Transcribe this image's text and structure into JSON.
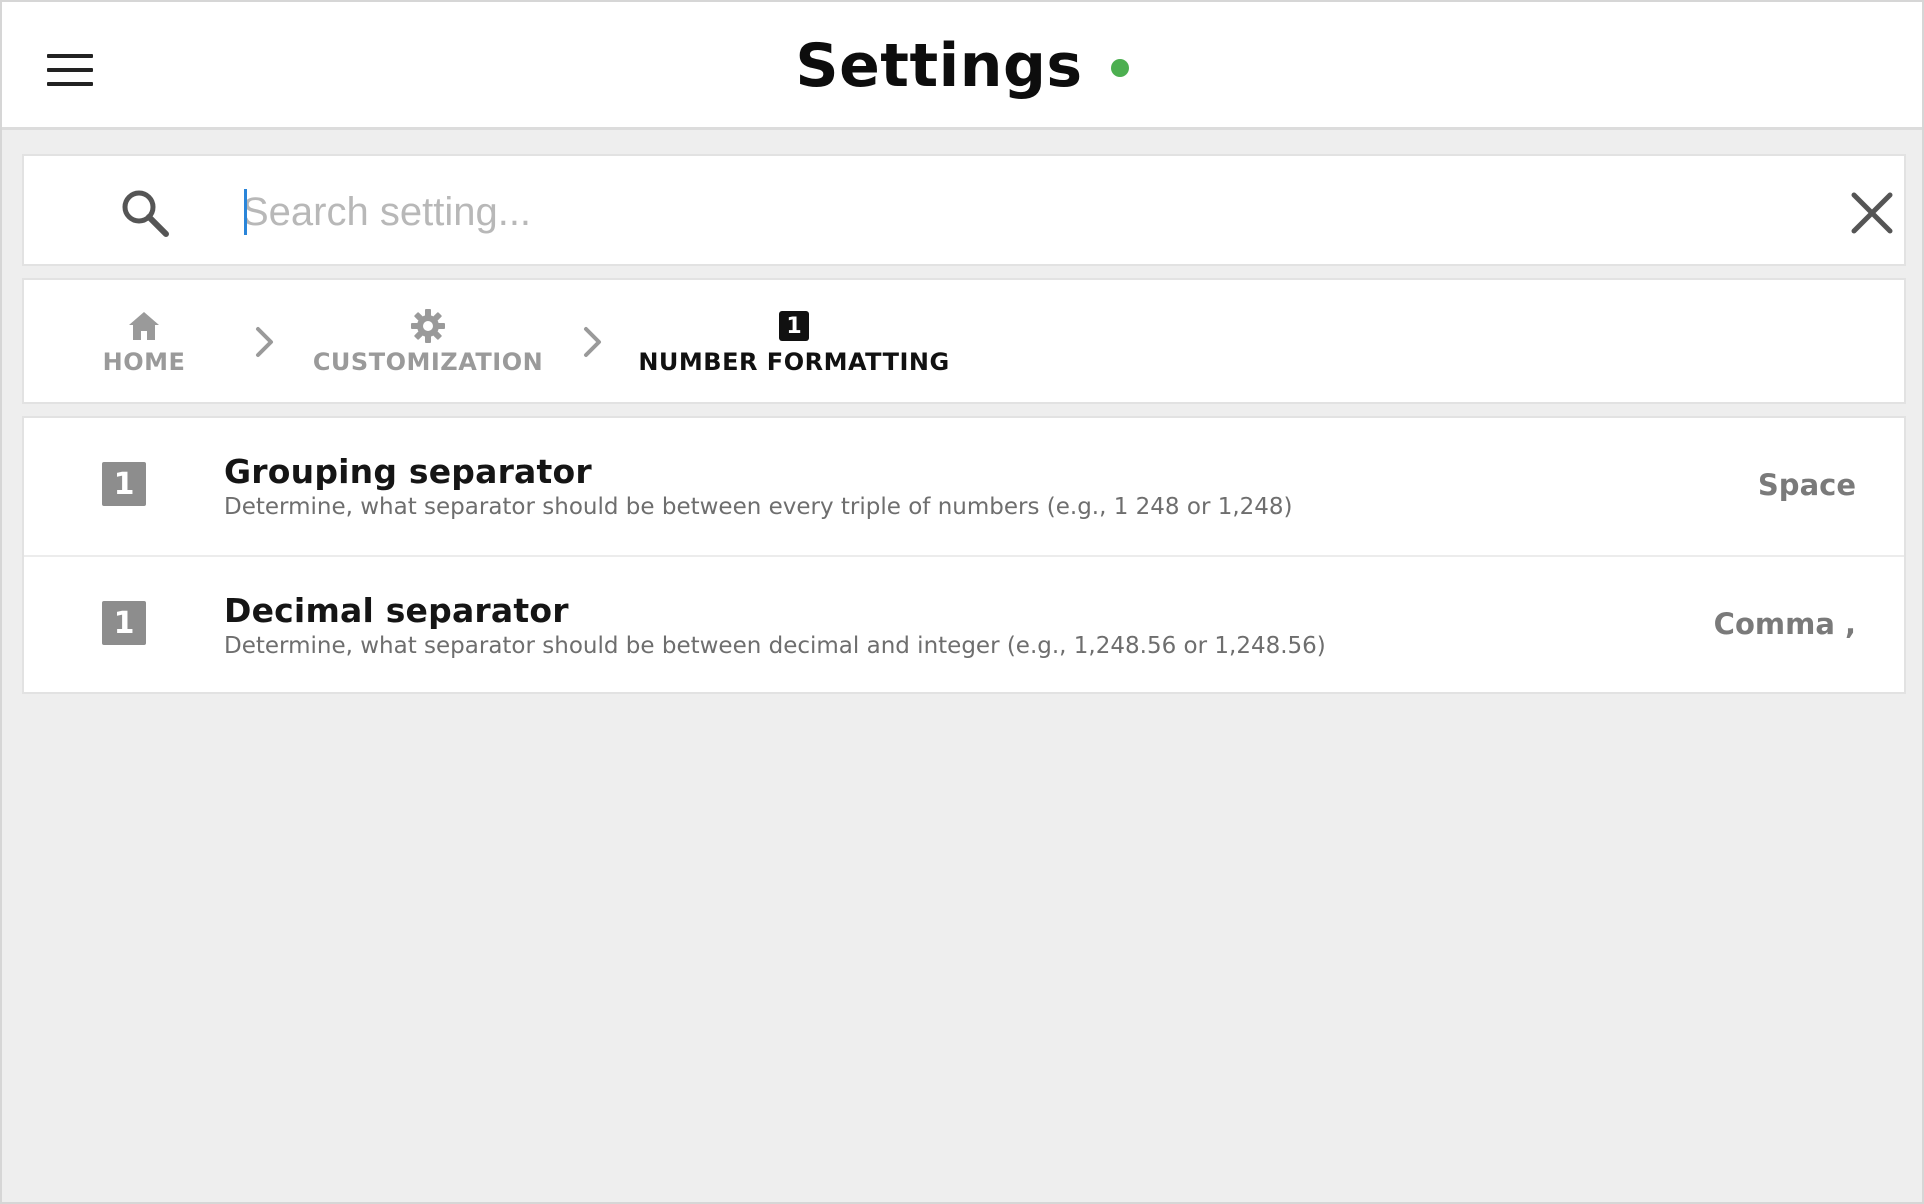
{
  "header": {
    "title": "Settings",
    "status_color": "#4caf50",
    "menu_icon": "hamburger-menu-icon"
  },
  "search": {
    "placeholder": "Search setting...",
    "value": "",
    "search_icon": "search-icon",
    "clear_icon": "close-icon"
  },
  "breadcrumb": {
    "items": [
      {
        "label": "HOME",
        "icon": "home-icon"
      },
      {
        "label": "CUSTOMIZATION",
        "icon": "gear-icon"
      },
      {
        "label": "NUMBER FORMATTING",
        "icon": "number-badge-icon",
        "badge": "1",
        "active": true
      }
    ]
  },
  "settings": [
    {
      "badge": "1",
      "title": "Grouping separator",
      "description": "Determine, what separator should be between every triple of numbers (e.g., 1 248 or 1,248)",
      "value": "Space"
    },
    {
      "badge": "1",
      "title": "Decimal separator",
      "description": "Determine, what separator should be between decimal and integer (e.g., 1,248.56 or 1,248.56)",
      "value": "Comma ,"
    }
  ]
}
